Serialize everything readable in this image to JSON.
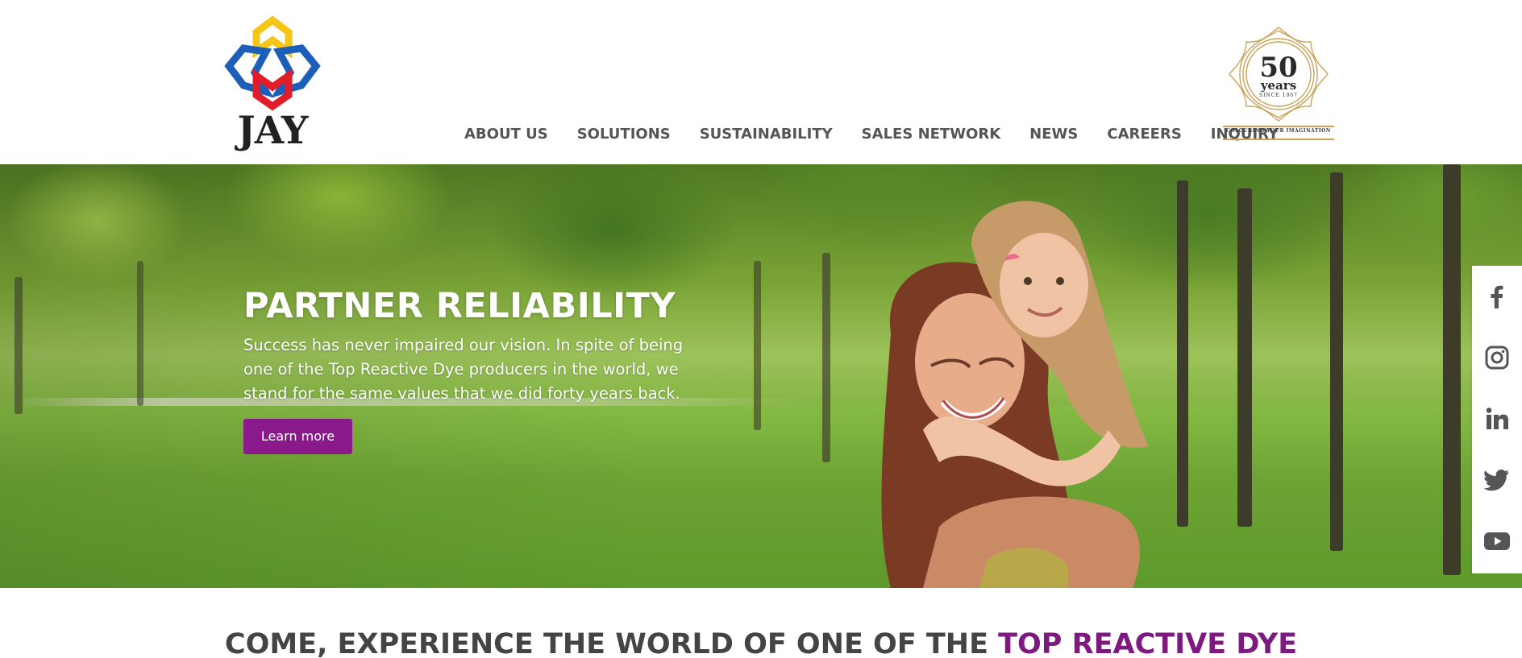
{
  "brand": {
    "logo_text": "JAY",
    "badge_number": "50",
    "badge_word": "years",
    "badge_since": "SINCE 1967",
    "badge_tagline": "COLOURING YOUR IMAGINATION"
  },
  "nav": {
    "items": [
      {
        "label": "ABOUT US"
      },
      {
        "label": "SOLUTIONS"
      },
      {
        "label": "SUSTAINABILITY"
      },
      {
        "label": "SALES NETWORK"
      },
      {
        "label": "NEWS"
      },
      {
        "label": "CAREERS"
      },
      {
        "label": "INQUIRY"
      }
    ]
  },
  "hero": {
    "title": "PARTNER RELIABILITY",
    "text": "Success has never impaired our vision. In spite of being one of the Top Reactive Dye producers in the world, we stand for the same values that we did forty years back.",
    "button_label": "Learn more"
  },
  "social": {
    "items": [
      {
        "icon": "facebook-icon"
      },
      {
        "icon": "instagram-icon"
      },
      {
        "icon": "linkedin-icon"
      },
      {
        "icon": "twitter-icon"
      },
      {
        "icon": "youtube-icon"
      }
    ]
  },
  "section": {
    "heading_part1": "COME, EXPERIENCE THE WORLD OF ONE OF THE ",
    "heading_accent": "TOP REACTIVE DYE"
  },
  "colors": {
    "accent": "#8a1a8c",
    "nav_text": "#555555",
    "badge_gold": "#c9a35a",
    "logo_yellow": "#f5c518",
    "logo_blue": "#1d5fb8",
    "logo_red": "#e11d2a"
  }
}
